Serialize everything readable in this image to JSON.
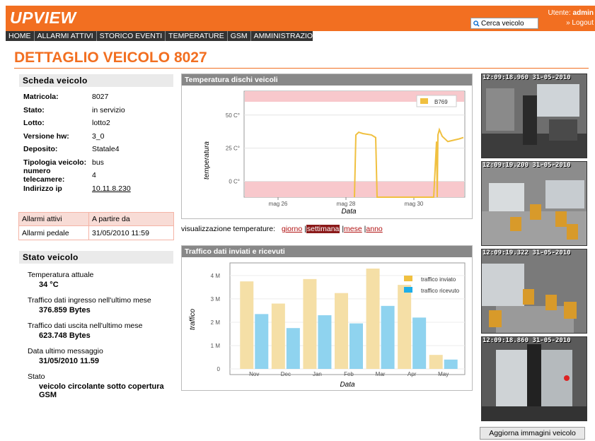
{
  "app": {
    "logo": "UPVIEW"
  },
  "search": {
    "placeholder": "Cerca veicolo"
  },
  "user": {
    "label": "Utente:",
    "name": "admin",
    "logout": "» Logout"
  },
  "nav": {
    "items": [
      "HOME",
      "ALLARMI ATTIVI",
      "STORICO EVENTI",
      "TEMPERATURE",
      "GSM",
      "AMMINISTRAZIONE"
    ]
  },
  "page": {
    "title": "DETTAGLIO VEICOLO 8027"
  },
  "scheda": {
    "title": "Scheda veicolo",
    "rows": [
      {
        "k": "Matricola:",
        "v": "8027"
      },
      {
        "k": "Stato:",
        "v": "in servizio"
      },
      {
        "k": "Lotto:",
        "v": "lotto2"
      },
      {
        "k": "Versione hw:",
        "v": "3_0"
      },
      {
        "k": "Deposito:",
        "v": "Statale4"
      },
      {
        "k": "Tipologia veicolo:",
        "v": "bus"
      },
      {
        "k": "numero telecamere:",
        "v": "4"
      },
      {
        "k": "Indirizzo ip",
        "v": "10.11.8.230"
      }
    ]
  },
  "alarms": {
    "headers": [
      "Allarmi attivi",
      "A partire da"
    ],
    "rows": [
      {
        "name": "Allarmi pedale",
        "since": "31/05/2010 11:59"
      }
    ]
  },
  "stato": {
    "title": "Stato veicolo",
    "items": [
      {
        "label": "Temperatura attuale",
        "value": "34 °C"
      },
      {
        "label": "Traffico dati ingresso nell'ultimo mese",
        "value": "376.859 Bytes"
      },
      {
        "label": "Traffico dati uscita nell'ultimo mese",
        "value": "623.748 Bytes"
      },
      {
        "label": "Data ultimo messaggio",
        "value": "31/05/2010 11.59"
      },
      {
        "label": "Stato",
        "value": "veicolo circolante sotto copertura GSM"
      }
    ]
  },
  "temp_chart": {
    "header": "Temperatura dischi veicoli",
    "ylabel": "temperatura",
    "xlabel": "Data",
    "yticks": [
      "50 C°",
      "25 C°",
      "0 C°"
    ],
    "xticks": [
      "mag 26",
      "mag 28",
      "mag 30"
    ],
    "legend": "B769"
  },
  "viz": {
    "label": "visualizzazione temperature:",
    "options": [
      "giorno",
      "settimana",
      "mese",
      "anno"
    ],
    "separator": "|"
  },
  "traffic_chart": {
    "header": "Traffico dati inviati e ricevuti",
    "ylabel": "traffico",
    "xlabel": "Data",
    "yticks": [
      "4 M",
      "3 M",
      "2 M",
      "1 M",
      "0"
    ],
    "legend": [
      "traffico inviato",
      "traffico ricevuto"
    ]
  },
  "chart_data": [
    {
      "type": "line",
      "title": "Temperatura dischi veicoli",
      "xlabel": "Data",
      "ylabel": "temperatura",
      "series": [
        {
          "name": "B769",
          "color": "#f0c040",
          "points": [
            [
              "2010-05-28T06:00",
              -12
            ],
            [
              "2010-05-28T07:00",
              35
            ],
            [
              "2010-05-28T09:00",
              37
            ],
            [
              "2010-05-28T12:00",
              36
            ],
            [
              "2010-05-28T18:00",
              35
            ],
            [
              "2010-05-28T21:00",
              33
            ],
            [
              "2010-05-28T22:00",
              -12
            ],
            [
              "2010-05-30T14:00",
              -12
            ],
            [
              "2010-05-30T16:00",
              30
            ],
            [
              "2010-05-30T16:30",
              -12
            ],
            [
              "2010-05-30T17:00",
              35
            ],
            [
              "2010-05-30T18:00",
              39
            ],
            [
              "2010-05-30T20:00",
              34
            ],
            [
              "2010-05-31T00:00",
              30
            ],
            [
              "2010-05-31T04:00",
              31
            ],
            [
              "2010-05-31T08:00",
              32
            ],
            [
              "2010-05-31T11:00",
              33
            ]
          ]
        }
      ],
      "bands": [
        {
          "from": 60,
          "to": 68,
          "color": "#f8c8cc"
        },
        {
          "from": -12,
          "to": 0,
          "color": "#f8c8cc"
        }
      ]
    },
    {
      "type": "bar",
      "title": "Traffico dati inviati e ricevuti",
      "xlabel": "Data",
      "ylabel": "traffico",
      "categories": [
        "Nov",
        "Dec",
        "Jan",
        "Feb",
        "Mar",
        "Apr",
        "May"
      ],
      "ylim": [
        0,
        4.3
      ],
      "series": [
        {
          "name": "traffico inviato",
          "color": "#f5dfa6",
          "values": [
            3.75,
            2.8,
            3.85,
            3.25,
            4.3,
            3.6,
            0.6
          ]
        },
        {
          "name": "traffico ricevuto",
          "color": "#8fd3ef",
          "values": [
            2.35,
            1.75,
            2.3,
            1.95,
            2.7,
            2.2,
            0.4
          ]
        }
      ]
    }
  ],
  "cameras": {
    "timestamps": [
      "12:09:18.960 31-05-2010",
      "12:09:19.200 31-05-2010",
      "12:09:19.322 31-05-2010",
      "12:09:18.860 31-05-2010"
    ],
    "refresh_label": "Aggiorna immagini veicolo"
  }
}
